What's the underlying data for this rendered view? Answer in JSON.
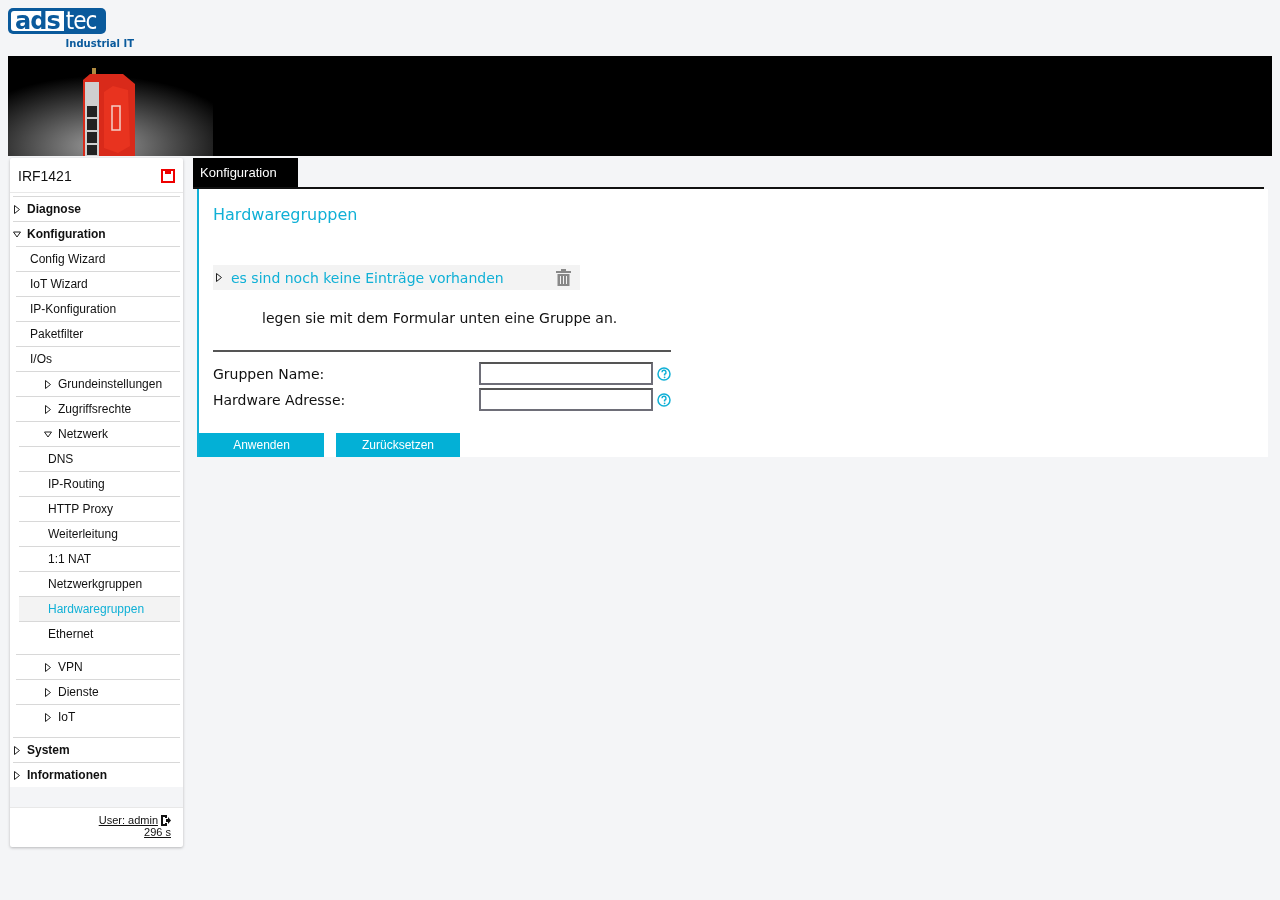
{
  "logo": {
    "word_1": "ads",
    "word_2": "tec",
    "tagline": "Industrial IT"
  },
  "sidebar": {
    "device": "IRF1421",
    "nav": [
      {
        "label": "Diagnose",
        "expanded": false,
        "selected": false
      },
      {
        "label": "Konfiguration",
        "expanded": true,
        "selected": false,
        "children": [
          {
            "label": "Config Wizard",
            "selected": false
          },
          {
            "label": "IoT Wizard",
            "selected": false
          },
          {
            "label": "IP-Konfiguration",
            "selected": false
          },
          {
            "label": "Paketfilter",
            "selected": false
          },
          {
            "label": "I/Os",
            "selected": false,
            "children": [
              {
                "label": "Grundeinstellungen",
                "expanded": false,
                "selected": false
              },
              {
                "label": "Zugriffsrechte",
                "expanded": false,
                "selected": false
              },
              {
                "label": "Netzwerk",
                "expanded": true,
                "selected": false,
                "children": [
                  {
                    "label": "DNS",
                    "selected": false
                  },
                  {
                    "label": "IP-Routing",
                    "selected": false
                  },
                  {
                    "label": "HTTP Proxy",
                    "selected": false
                  },
                  {
                    "label": "Weiterleitung",
                    "selected": false
                  },
                  {
                    "label": "1:1 NAT",
                    "selected": false
                  },
                  {
                    "label": "Netzwerkgruppen",
                    "selected": false
                  },
                  {
                    "label": "Hardwaregruppen",
                    "selected": true
                  },
                  {
                    "label": "Ethernet",
                    "selected": false
                  }
                ]
              },
              {
                "label": "VPN",
                "expanded": false,
                "selected": false
              },
              {
                "label": "Dienste",
                "expanded": false,
                "selected": false
              },
              {
                "label": "IoT",
                "expanded": false,
                "selected": false
              }
            ]
          }
        ]
      },
      {
        "label": "System",
        "expanded": false,
        "selected": false
      },
      {
        "label": "Informationen",
        "expanded": false,
        "selected": false
      }
    ],
    "user_link": "User: admin",
    "timer": "296 s"
  },
  "tabs": [
    {
      "label": "Konfiguration",
      "selected": true
    }
  ],
  "content": {
    "title": "Hardwaregruppen",
    "entries_row": {
      "text": "es sind noch keine Einträge vorhanden",
      "expanded": false
    },
    "hint": "legen sie mit dem Formular unten eine Gruppe an.",
    "fields": [
      {
        "label": "Gruppen Name:"
      },
      {
        "label": "Hardware Adresse:"
      }
    ],
    "buttons": [
      "Anwenden",
      "Zurücksetzen"
    ]
  }
}
